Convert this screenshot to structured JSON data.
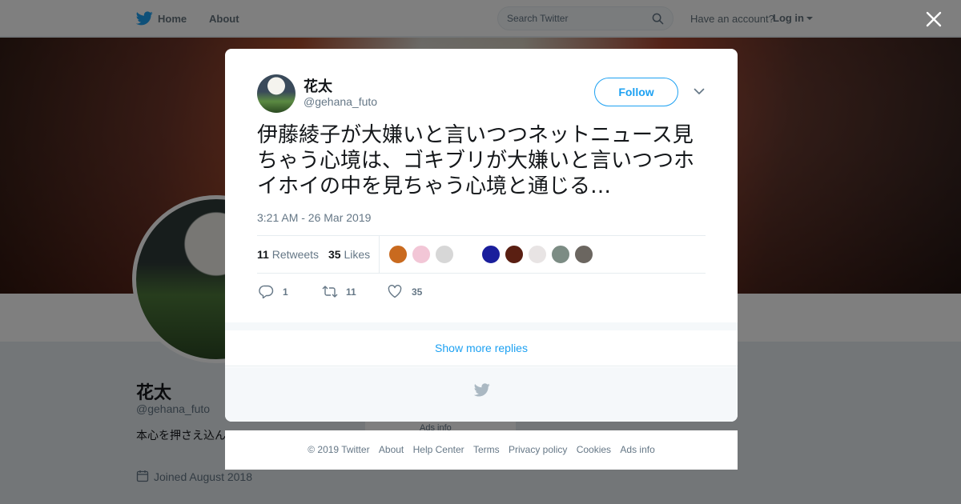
{
  "nav": {
    "home": "Home",
    "about": "About",
    "search_placeholder": "Search Twitter",
    "have_account": "Have an account?",
    "login": "Log in"
  },
  "profile": {
    "name": "花太",
    "handle": "@gehana_futo",
    "bio": "本心を押さえ込んで…で。",
    "joined": "Joined August 2018",
    "ads_info": "Ads info"
  },
  "tweet": {
    "author_name": "花太",
    "author_handle": "@gehana_futo",
    "follow_label": "Follow",
    "text": "伊藤綾子が大嫌いと言いつつネットニュース見ちゃう心境は、ゴキブリが大嫌いと言いつつホイホイの中を見ちゃう心境と通じる…",
    "timestamp": "3:21 AM - 26 Mar 2019",
    "retweets_count": "11",
    "retweets_label": "Retweets",
    "likes_count": "35",
    "likes_label": "Likes",
    "reply_count": "1",
    "retweet_action_count": "11",
    "like_action_count": "35",
    "likers": [
      "#c96a1f",
      "#f2c6d6",
      "#d7d7d7",
      "#1a1e9c",
      "#5a1f12",
      "#e8e4e4",
      "#7c8c84",
      "#6b6660"
    ]
  },
  "modal": {
    "show_more": "Show more replies"
  },
  "footer": {
    "copyright": "© 2019 Twitter",
    "about": "About",
    "help": "Help Center",
    "terms": "Terms",
    "privacy": "Privacy policy",
    "cookies": "Cookies",
    "ads": "Ads info"
  },
  "colors": {
    "accent": "#1da1f2",
    "muted": "#657786",
    "text": "#14171a"
  }
}
